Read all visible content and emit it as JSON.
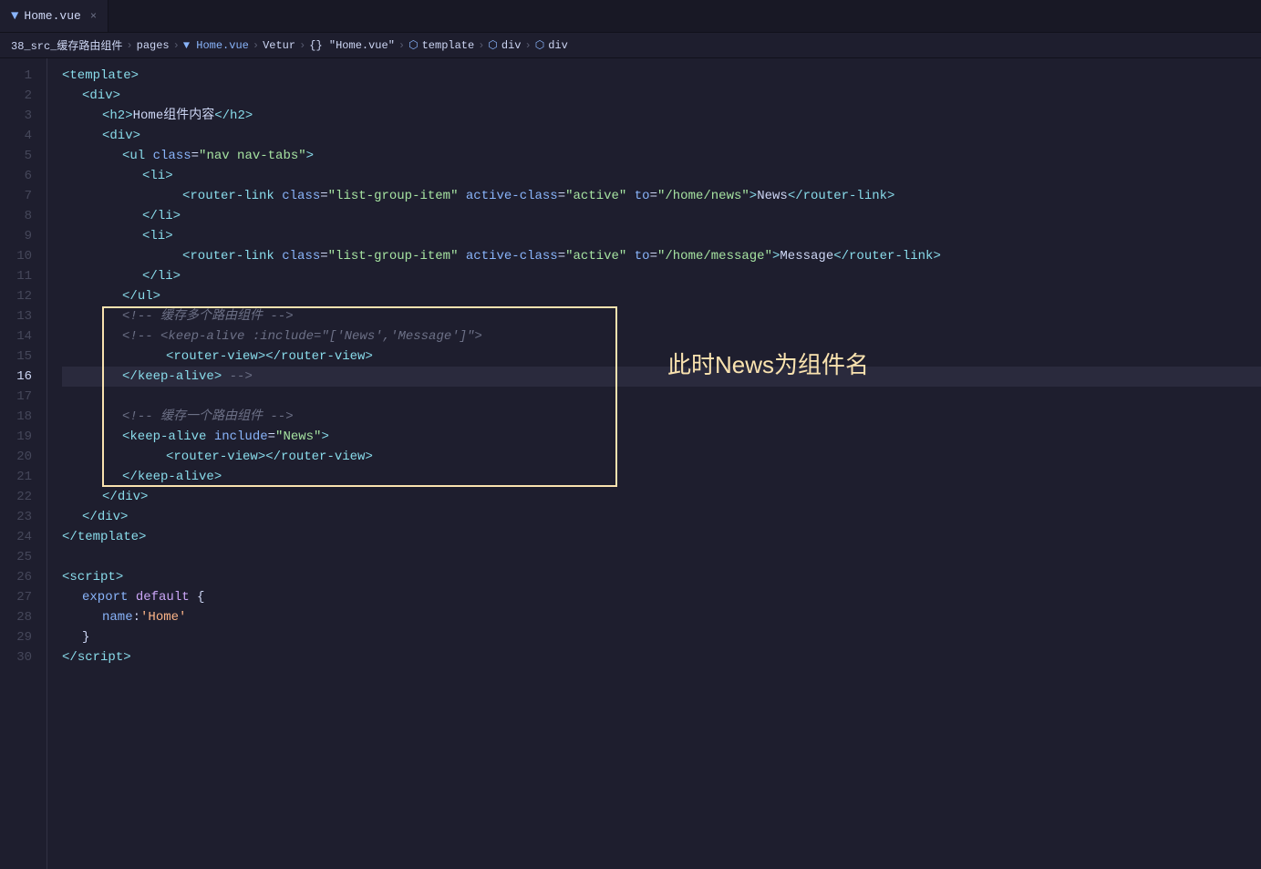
{
  "tab": {
    "icon": "▼",
    "label": "Home.vue",
    "close": "×"
  },
  "breadcrumb": {
    "items": [
      {
        "text": "38_src_缓存路由组件",
        "type": "text"
      },
      {
        "text": ">",
        "type": "sep"
      },
      {
        "text": "pages",
        "type": "text"
      },
      {
        "text": ">",
        "type": "sep"
      },
      {
        "text": "▼ Home.vue",
        "type": "vue"
      },
      {
        "text": ">",
        "type": "sep"
      },
      {
        "text": "Vetur",
        "type": "text"
      },
      {
        "text": ">",
        "type": "sep"
      },
      {
        "text": "{} \"Home.vue\"",
        "type": "icon-text"
      },
      {
        "text": ">",
        "type": "sep"
      },
      {
        "text": "⬡ template",
        "type": "icon-text"
      },
      {
        "text": ">",
        "type": "sep"
      },
      {
        "text": "⬡ div",
        "type": "icon-text"
      },
      {
        "text": ">",
        "type": "sep"
      },
      {
        "text": "⬡ div",
        "type": "icon-text"
      }
    ]
  },
  "annotation": "此时News为组件名",
  "lines": [
    {
      "num": 1,
      "active": false
    },
    {
      "num": 2,
      "active": false
    },
    {
      "num": 3,
      "active": false
    },
    {
      "num": 4,
      "active": false
    },
    {
      "num": 5,
      "active": false
    },
    {
      "num": 6,
      "active": false
    },
    {
      "num": 7,
      "active": false
    },
    {
      "num": 8,
      "active": false
    },
    {
      "num": 9,
      "active": false
    },
    {
      "num": 10,
      "active": false
    },
    {
      "num": 11,
      "active": false
    },
    {
      "num": 12,
      "active": false
    },
    {
      "num": 13,
      "active": false
    },
    {
      "num": 14,
      "active": false
    },
    {
      "num": 15,
      "active": false
    },
    {
      "num": 16,
      "active": true
    },
    {
      "num": 17,
      "active": false
    },
    {
      "num": 18,
      "active": false
    },
    {
      "num": 19,
      "active": false
    },
    {
      "num": 20,
      "active": false
    },
    {
      "num": 21,
      "active": false
    },
    {
      "num": 22,
      "active": false
    },
    {
      "num": 23,
      "active": false
    },
    {
      "num": 24,
      "active": false
    },
    {
      "num": 25,
      "active": false
    },
    {
      "num": 26,
      "active": false
    },
    {
      "num": 27,
      "active": false
    },
    {
      "num": 28,
      "active": false
    },
    {
      "num": 29,
      "active": false
    },
    {
      "num": 30,
      "active": false
    }
  ]
}
